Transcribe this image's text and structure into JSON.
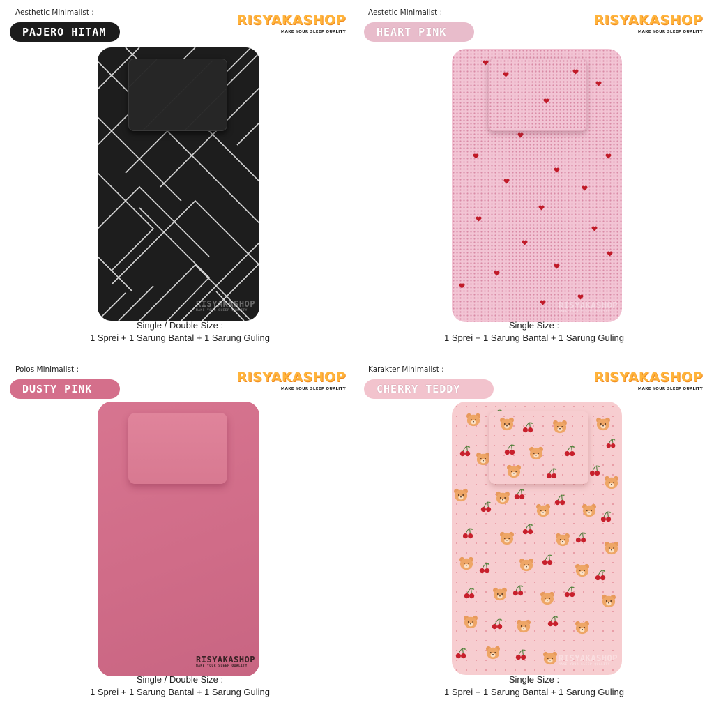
{
  "brand": {
    "name": "RISYAKASHOP",
    "tagline": "MAKE YOUR SLEEP QUALITY"
  },
  "products": [
    {
      "category": "Aesthetic Minimalist :",
      "name": "PAJERO HITAM",
      "size_line": "Single / Double Size :",
      "contents_line": "1 Sprei + 1 Sarung Bantal + 1 Sarung Guling",
      "color": "#1c1c1c"
    },
    {
      "category": "Aestetic Minimalist :",
      "name": "HEART PINK",
      "size_line": "Single Size :",
      "contents_line": "1 Sprei + 1 Sarung Bantal + 1 Sarung Guling",
      "color": "#f3c6d6"
    },
    {
      "category": "Polos Minimalist :",
      "name": "DUSTY PINK",
      "size_line": "Single / Double Size :",
      "contents_line": "1 Sprei + 1 Sarung Bantal + 1 Sarung Guling",
      "color": "#d46f8b"
    },
    {
      "category": "Karakter Minimalist :",
      "name": "CHERRY TEDDY",
      "size_line": "Single Size :",
      "contents_line": "1 Sprei + 1 Sarung Bantal + 1 Sarung Guling",
      "color": "#f6c9c9"
    }
  ],
  "colors": {
    "brand_orange": "#ffb43c",
    "black_sheet": "#1c1c1c",
    "heart_red": "#c01a28",
    "dusty_pink": "#d46f8b",
    "teddy_pink": "#f6c9c9"
  }
}
